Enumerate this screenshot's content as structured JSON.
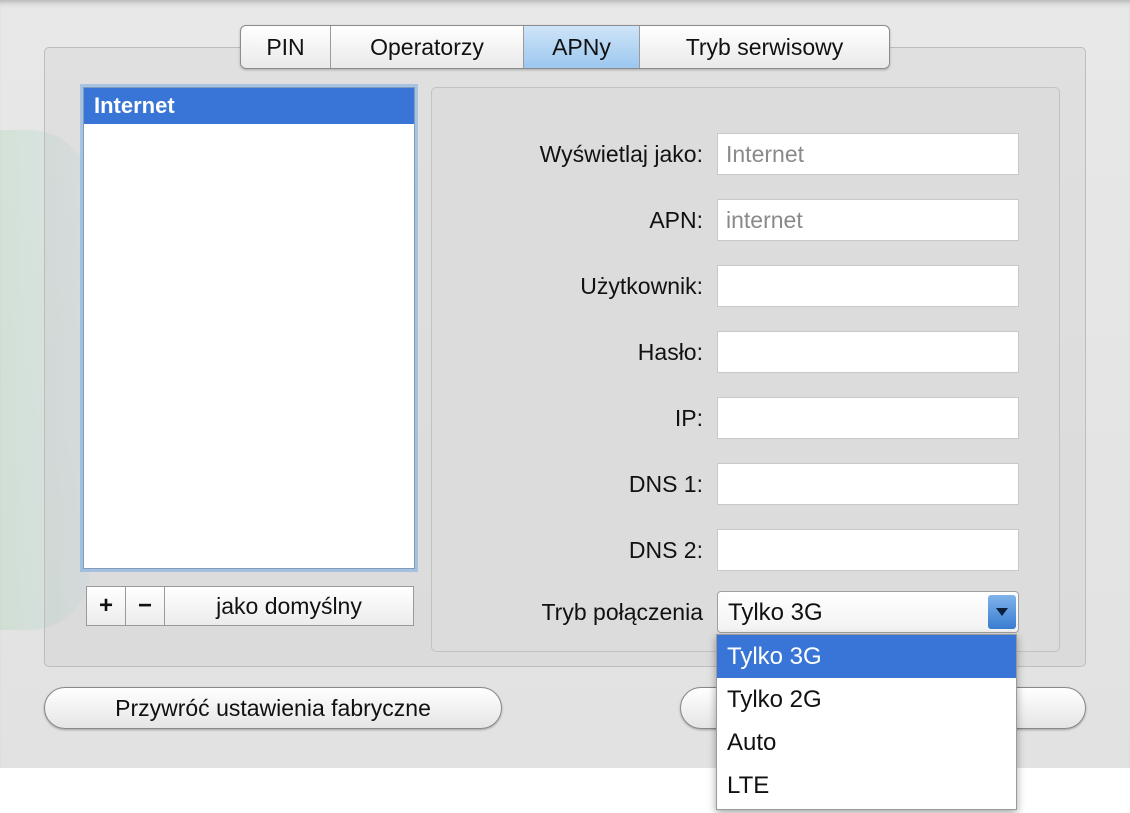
{
  "tabs": [
    {
      "label": "PIN",
      "active": false
    },
    {
      "label": "Operatorzy",
      "active": false
    },
    {
      "label": "APNy",
      "active": true
    },
    {
      "label": "Tryb serwisowy",
      "active": false
    }
  ],
  "apn_list": {
    "items": [
      "Internet"
    ],
    "selected": "Internet",
    "add_label": "+",
    "remove_label": "−",
    "default_label": "jako domyślny"
  },
  "fields": {
    "display_as": {
      "label": "Wyświetlaj jako:",
      "value": "Internet"
    },
    "apn": {
      "label": "APN:",
      "value": "internet"
    },
    "user": {
      "label": "Użytkownik:",
      "value": ""
    },
    "password": {
      "label": "Hasło:",
      "value": ""
    },
    "ip": {
      "label": "IP:",
      "value": ""
    },
    "dns1": {
      "label": "DNS 1:",
      "value": ""
    },
    "dns2": {
      "label": "DNS 2:",
      "value": ""
    },
    "connection_mode": {
      "label": "Tryb połączenia",
      "value": "Tylko 3G"
    }
  },
  "connection_options": [
    "Tylko 3G",
    "Tylko 2G",
    "Auto",
    "LTE"
  ],
  "buttons": {
    "reset": "Przywróć ustawienia fabryczne"
  },
  "colors": {
    "selection": "#3875d7",
    "active_tab": "#9cc7ef"
  },
  "icons": {
    "popup_arrow": "chevron-down-icon"
  }
}
